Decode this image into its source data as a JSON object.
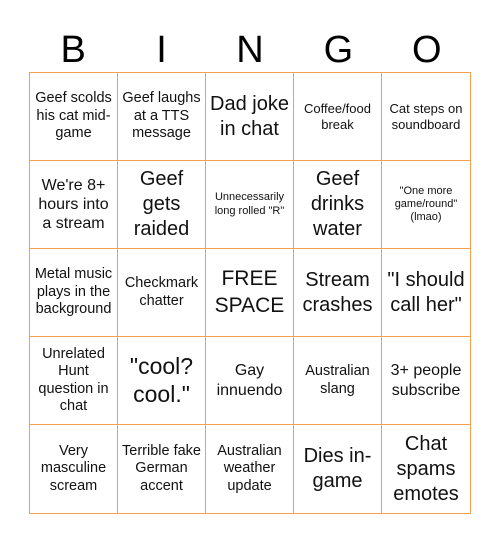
{
  "header": {
    "letters": [
      "B",
      "I",
      "N",
      "G",
      "O"
    ]
  },
  "colors": {
    "grid_border": "#f5a04f",
    "text": "#111111",
    "background": "#ffffff"
  },
  "board": {
    "cells": [
      "Geef scolds his cat mid-game",
      "Geef laughs at a TTS message",
      "Dad joke in chat",
      "Coffee/food break",
      "Cat steps on soundboard",
      "We're 8+ hours into a stream",
      "Geef gets raided",
      "Unnecessarily long rolled \"R\"",
      "Geef drinks water",
      "\"One more game/round\" (lmao)",
      "Metal music plays in the background",
      "Checkmark chatter",
      "FREE SPACE",
      "Stream crashes",
      "\"I should call her\"",
      "Unrelated Hunt question in chat",
      "\"cool? cool.\"",
      "Gay innuendo",
      "Australian slang",
      "3+ people subscribe",
      "Very masculine scream",
      "Terrible fake German accent",
      "Australian weather update",
      "Dies in-game",
      "Chat spams emotes"
    ]
  }
}
